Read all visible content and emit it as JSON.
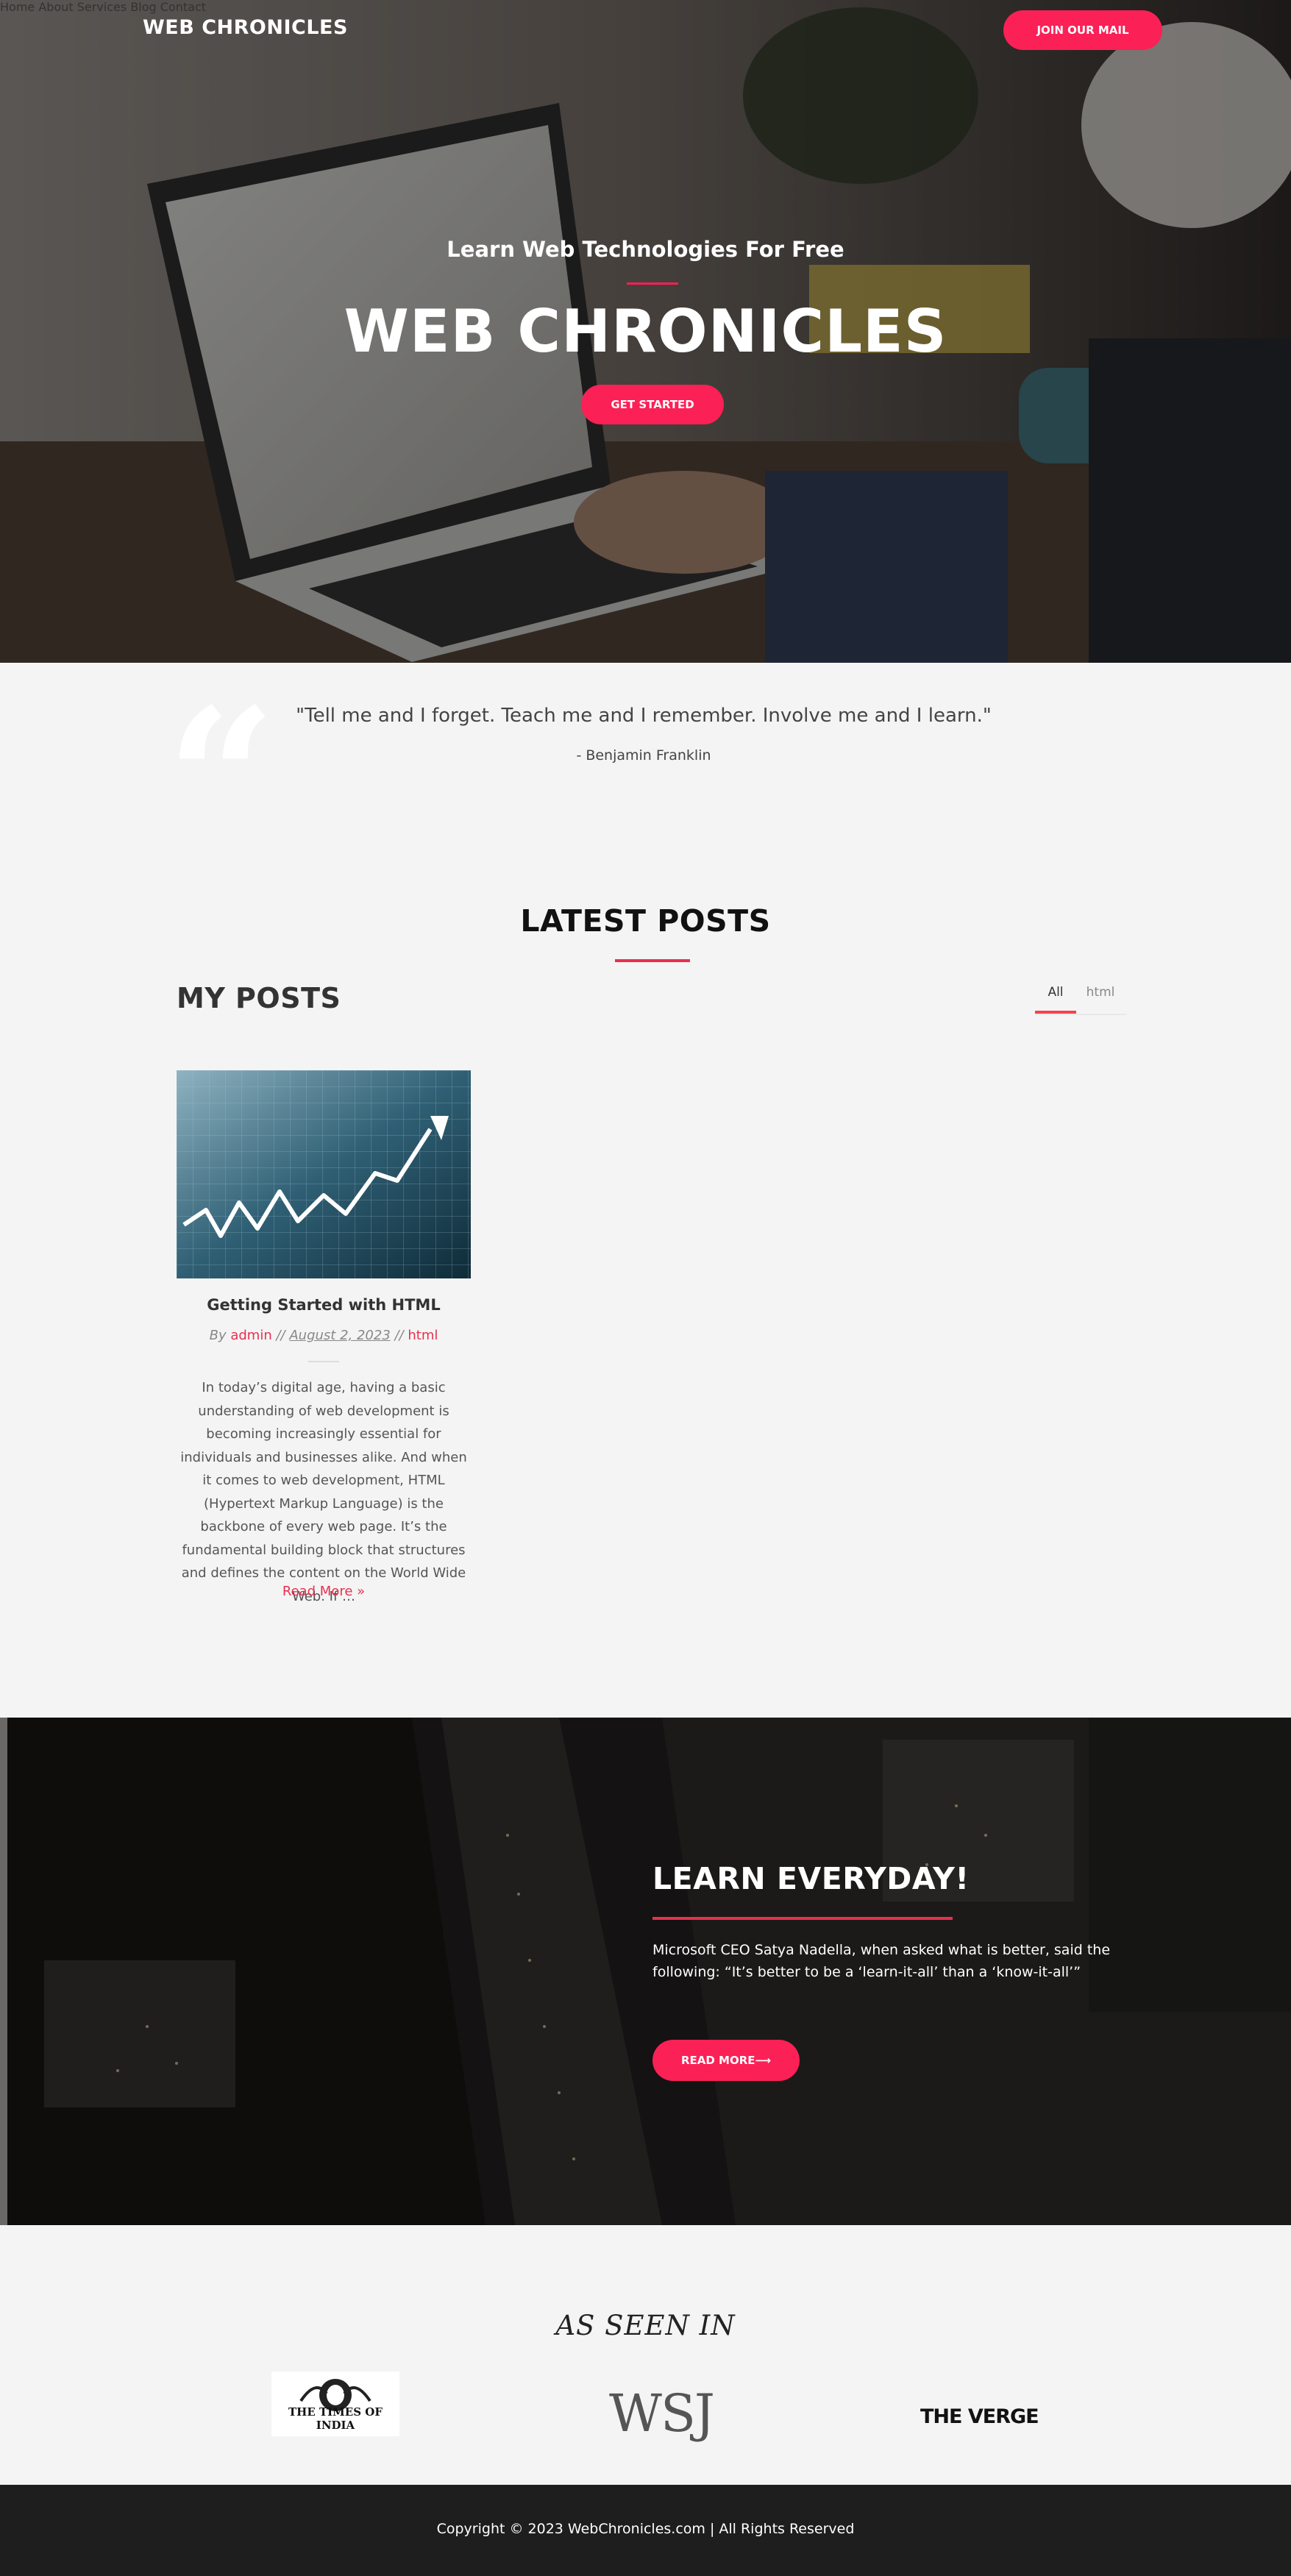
{
  "header": {
    "brand": "WEB CHRONICLES",
    "nav": [
      "Home",
      "About",
      "Services",
      "Blog",
      "Contact"
    ],
    "cta_label": "JOIN OUR MAIL"
  },
  "hero": {
    "subtitle": "Learn Web Technologies For Free",
    "title": "WEB CHRONICLES",
    "button_label": "GET STARTED"
  },
  "quote": {
    "text": "\"Tell me and I forget. Teach me and I remember. Involve me and I learn.\"",
    "author": "- Benjamin Franklin"
  },
  "latest_posts": {
    "title": "LATEST POSTS",
    "subtitle": "MY POSTS",
    "filters": [
      "All",
      "html"
    ],
    "active_filter": "All",
    "posts": [
      {
        "title": "Getting Started with HTML",
        "by_label": "By",
        "author": "admin",
        "separator": "//",
        "date": "August 2, 2023",
        "category": "html",
        "excerpt": "In today’s digital age, having a basic understanding of web development is becoming increasingly essential for individuals and businesses alike. And when it comes to web development, HTML (Hypertext Markup Language) is the backbone of every web page. It’s the fundamental building block that structures and defines the content on the World Wide Web. If …",
        "read_more": "Read More »"
      }
    ]
  },
  "learn": {
    "title": "LEARN EVERYDAY!",
    "text": "Microsoft CEO Satya Nadella, when asked what is better, said the following: “It’s better to be a ‘learn-it-all’ than a ‘know-it-all’”",
    "button_label": "READ MORE⟶"
  },
  "seen_in": {
    "title": "AS SEEN IN",
    "logos": [
      "THE TIMES OF INDIA",
      "WSJ",
      "THE VERGE"
    ]
  },
  "footer": {
    "copyright": "Copyright © 2023 WebChronicles.com | All Rights Reserved"
  },
  "colors": {
    "accent": "#fb2056",
    "footer_bg": "#1e1e1e",
    "page_bg": "#f4f4f4"
  }
}
